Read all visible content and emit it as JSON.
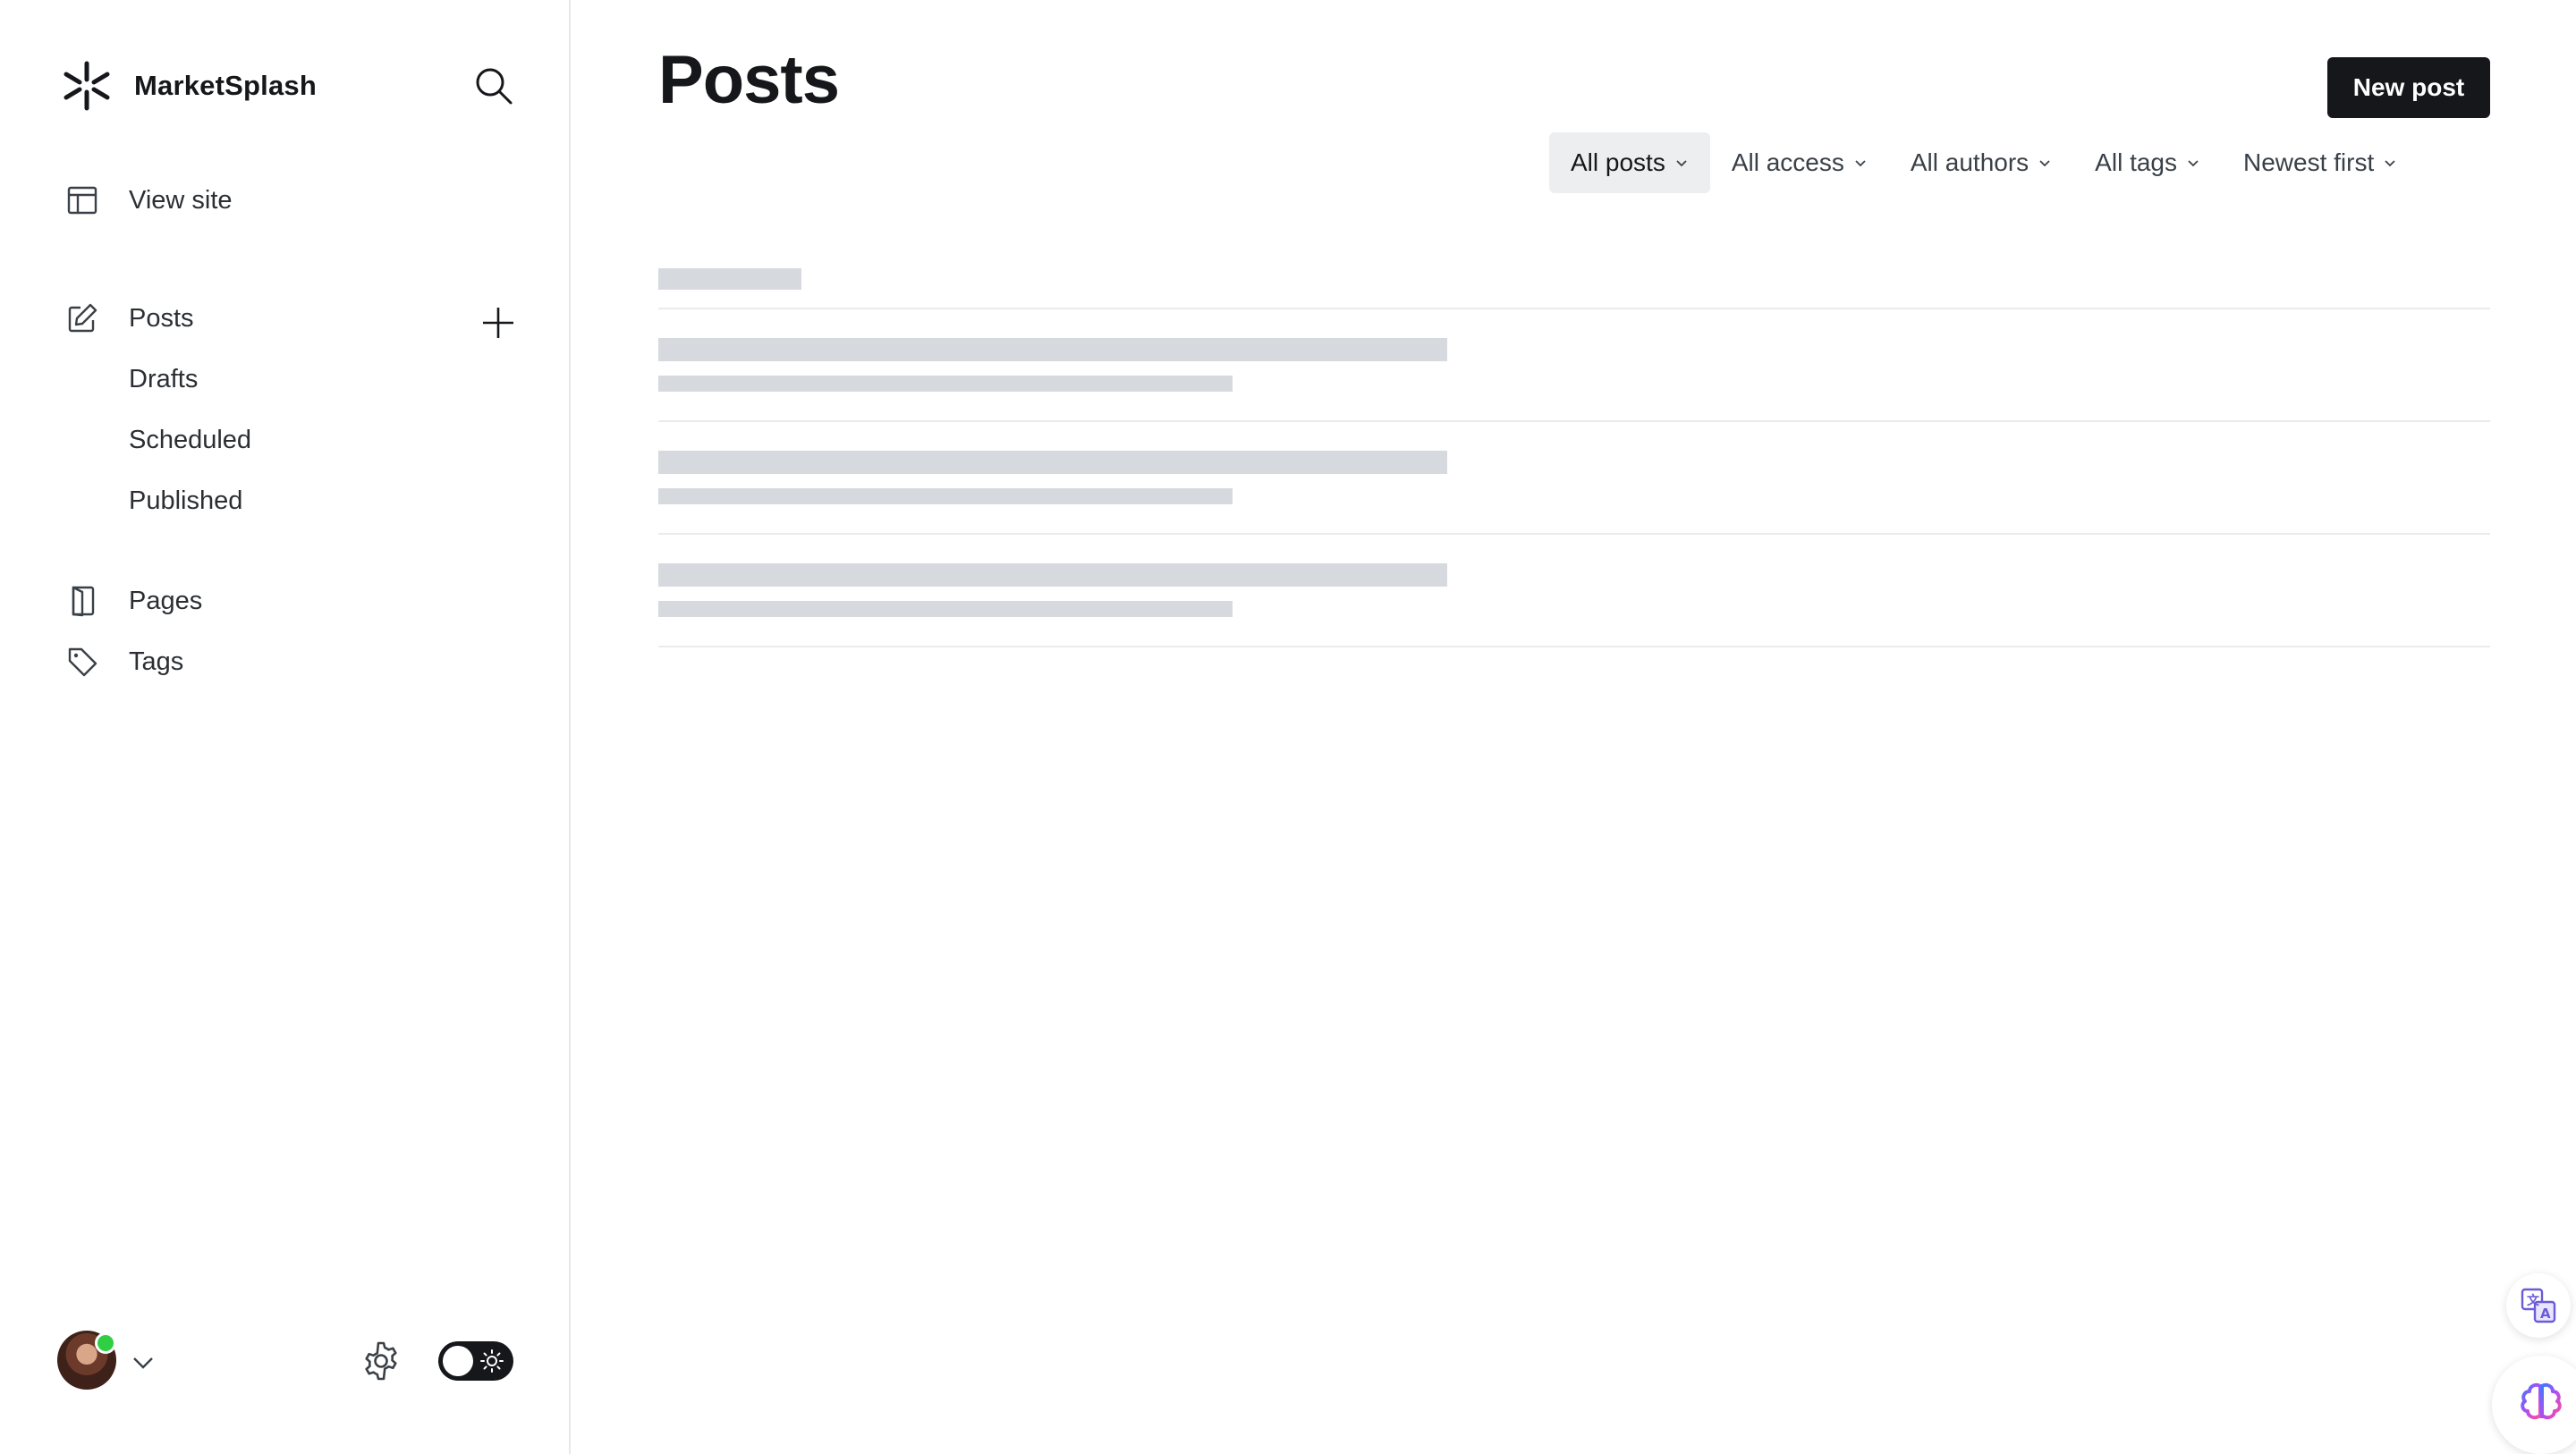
{
  "sidebar": {
    "brand_name": "MarketSplash",
    "nav": {
      "view_site": "View site",
      "posts": "Posts",
      "drafts": "Drafts",
      "scheduled": "Scheduled",
      "published": "Published",
      "pages": "Pages",
      "tags": "Tags"
    }
  },
  "main": {
    "title": "Posts",
    "new_post_label": "New post",
    "filters": [
      {
        "label": "All posts",
        "active": true
      },
      {
        "label": "All access",
        "active": false
      },
      {
        "label": "All authors",
        "active": false
      },
      {
        "label": "All tags",
        "active": false
      },
      {
        "label": "Newest first",
        "active": false
      }
    ],
    "list_state": "loading"
  },
  "colors": {
    "accent_dark": "#15171a",
    "skeleton": "#d6dadf",
    "active_filter_bg": "#eceef0",
    "online_status": "#30cf43"
  },
  "icons": [
    "logo-asterisk-icon",
    "search-icon",
    "view-site-icon",
    "edit-icon",
    "plus-icon",
    "pages-icon",
    "tag-icon",
    "chevron-down-icon",
    "gear-icon",
    "sun-icon",
    "translate-icon",
    "brain-icon"
  ]
}
